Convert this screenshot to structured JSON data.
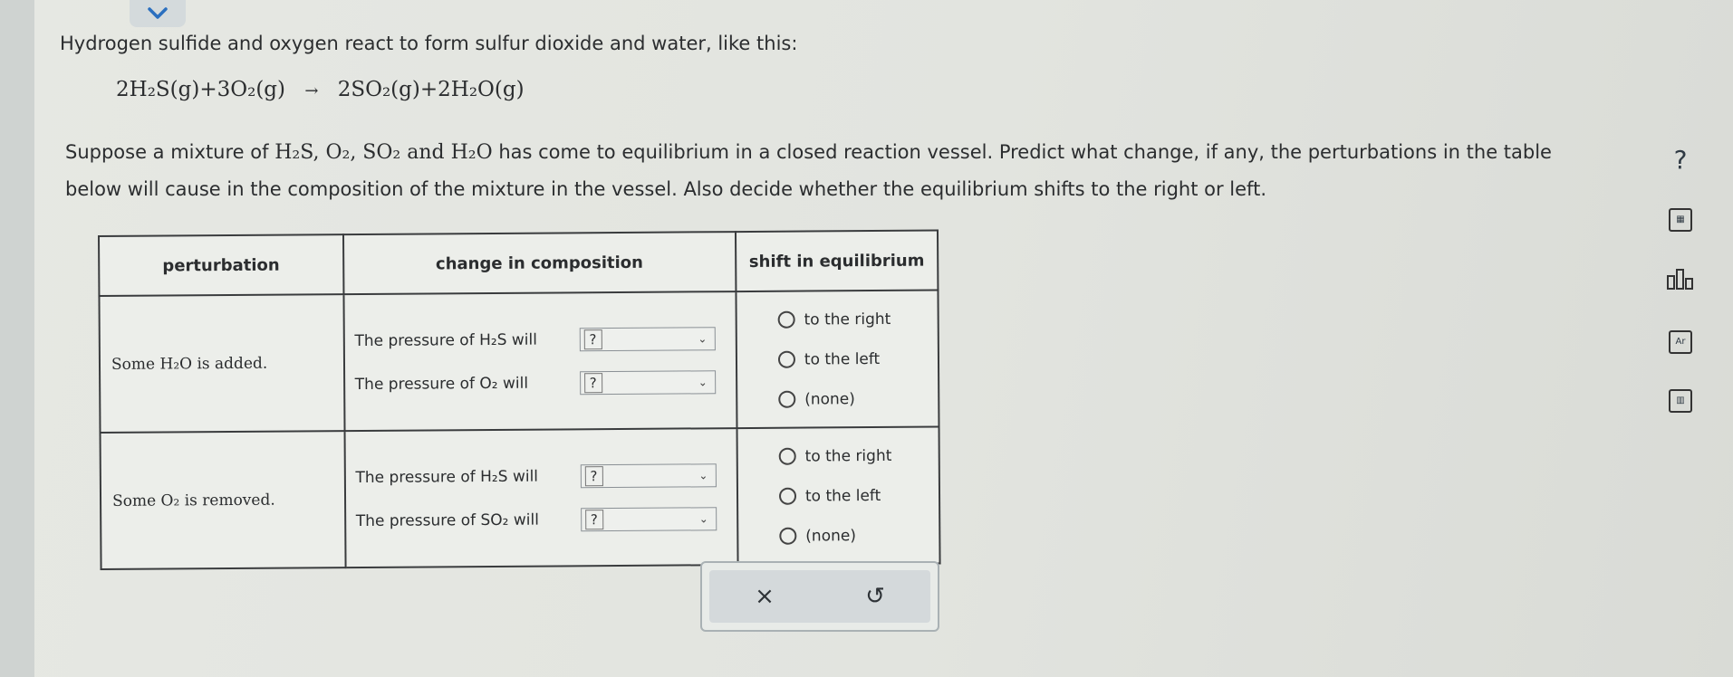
{
  "header": {
    "intro": "Hydrogen sulfide and oxygen react to form sulfur dioxide and water, like this:",
    "reaction_left": "2H₂S(g)+3O₂(g)",
    "reaction_arrow": "→",
    "reaction_right": "2SO₂(g)+2H₂O(g)"
  },
  "prompt": {
    "part1": "Suppose a mixture of",
    "species": "H₂S, O₂, SO₂ and H₂O",
    "part2": "has come to equilibrium in a closed reaction vessel. Predict what change, if any, the perturbations in the table below will cause in the composition of the mixture in the vessel. Also decide whether the equilibrium shifts to the right or left."
  },
  "table": {
    "headers": [
      "perturbation",
      "change in composition",
      "shift in equilibrium"
    ],
    "rows": [
      {
        "perturbation": "Some H₂O is added.",
        "changes": [
          {
            "label": "The pressure of H₂S will",
            "value": "?"
          },
          {
            "label": "The pressure of O₂ will",
            "value": "?"
          }
        ],
        "options": [
          "to the right",
          "to the left",
          "(none)"
        ]
      },
      {
        "perturbation": "Some O₂ is removed.",
        "changes": [
          {
            "label": "The pressure of H₂S will",
            "value": "?"
          },
          {
            "label": "The pressure of SO₂ will",
            "value": "?"
          }
        ],
        "options": [
          "to the right",
          "to the left",
          "(none)"
        ]
      }
    ]
  },
  "actions": {
    "clear": "×",
    "undo": "↺"
  },
  "sidebar": {
    "help": "?",
    "calculator_icon": "calculator-icon",
    "chart_icon": "data-chart-icon",
    "periodic_label": "Ar",
    "reference_icon": "reference-icon"
  }
}
